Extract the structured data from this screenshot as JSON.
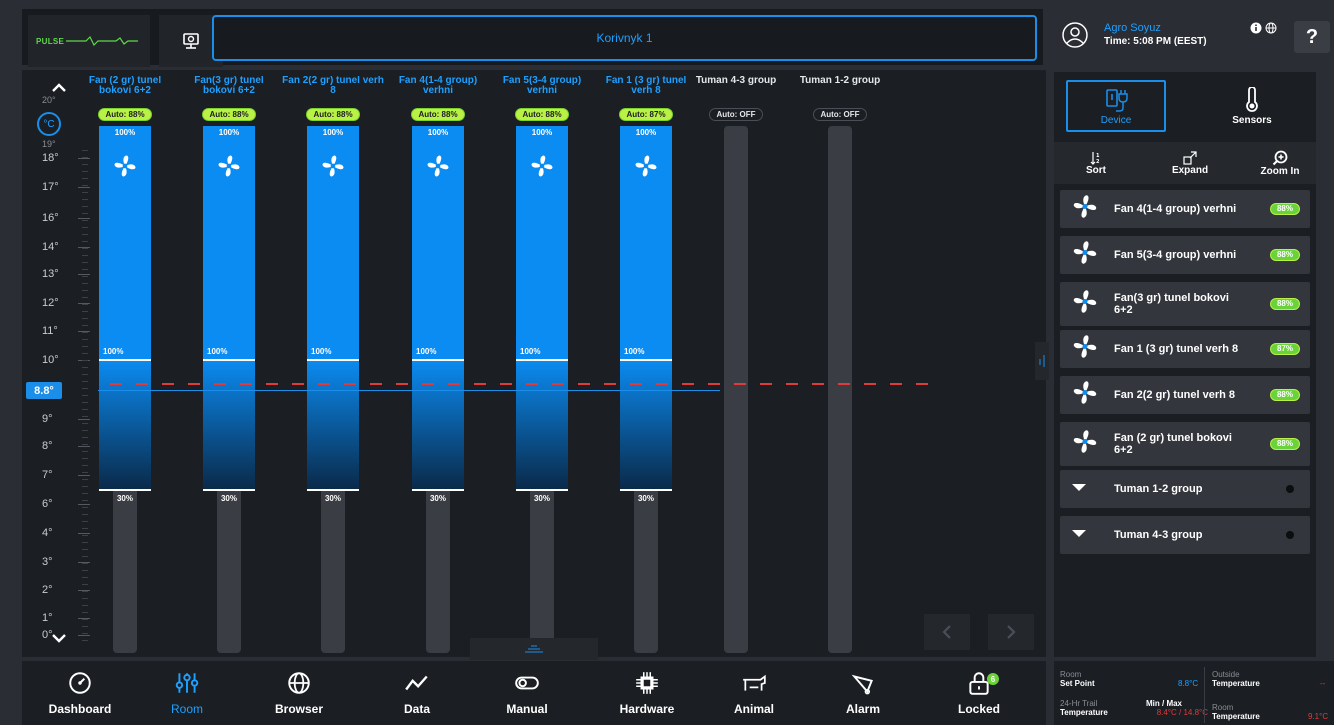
{
  "header": {
    "logo_text": "PULSE",
    "house_title": "Korivnyk 1"
  },
  "user": {
    "name": "Agro Soyuz",
    "time": "Time: 5:08 PM (EEST)",
    "help_label": "?",
    "icons": [
      "info-icon",
      "globe-icon"
    ]
  },
  "scale": {
    "unit": "°C",
    "current_temperature": "8.8°",
    "top_partial_label": "20°",
    "second_partial_label": "19°",
    "ticks": [
      "18°",
      "17°",
      "16°",
      "14°",
      "13°",
      "12°",
      "11°",
      "10°",
      "9°",
      "8°",
      "7°",
      "6°",
      "4°",
      "3°",
      "2°",
      "1°",
      "0°"
    ]
  },
  "columns": [
    {
      "title": "Fan (2 gr) tunel bokovi 6+2",
      "mode": "Auto: 88%",
      "active": true,
      "top_pct": "100%",
      "mid_pct": "100%",
      "min_pct": "30%",
      "icon": "fan-icon"
    },
    {
      "title": "Fan(3 gr) tunel bokovi 6+2",
      "mode": "Auto: 88%",
      "active": true,
      "top_pct": "100%",
      "mid_pct": "100%",
      "min_pct": "30%",
      "icon": "fan-icon"
    },
    {
      "title": "Fan 2(2 gr) tunel verh 8",
      "mode": "Auto: 88%",
      "active": true,
      "top_pct": "100%",
      "mid_pct": "100%",
      "min_pct": "30%",
      "icon": "fan-icon"
    },
    {
      "title": "Fan 4(1-4 group) verhni",
      "mode": "Auto: 88%",
      "active": true,
      "top_pct": "100%",
      "mid_pct": "100%",
      "min_pct": "30%",
      "icon": "fan-icon"
    },
    {
      "title": "Fan 5(3-4 group) verhni",
      "mode": "Auto: 88%",
      "active": true,
      "top_pct": "100%",
      "mid_pct": "100%",
      "min_pct": "30%",
      "icon": "fan-icon"
    },
    {
      "title": "Fan 1 (3 gr) tunel verh 8",
      "mode": "Auto: 87%",
      "active": true,
      "top_pct": "100%",
      "mid_pct": "100%",
      "min_pct": "30%",
      "icon": "fan-icon"
    },
    {
      "title": "Tuman 4-3 group",
      "mode": "Auto: OFF",
      "active": false
    },
    {
      "title": "Tuman 1-2 group",
      "mode": "Auto: OFF",
      "active": false
    }
  ],
  "right_panel": {
    "tabs": {
      "device": "Device",
      "sensors": "Sensors"
    },
    "tools": {
      "sort": "Sort",
      "expand": "Expand",
      "zoom": "Zoom In"
    },
    "devices": [
      {
        "name": "Fan 4(1-4 group) verhni",
        "badge": "88%",
        "icon": "fan-icon"
      },
      {
        "name": "Fan 5(3-4 group) verhni",
        "badge": "88%",
        "icon": "fan-icon"
      },
      {
        "name": "Fan(3 gr) tunel bokovi 6+2",
        "badge": "88%",
        "icon": "fan-icon"
      },
      {
        "name": "Fan 1 (3 gr) tunel verh 8",
        "badge": "87%",
        "icon": "fan-icon"
      },
      {
        "name": "Fan 2(2 gr) tunel verh 8",
        "badge": "88%",
        "icon": "fan-icon"
      },
      {
        "name": "Fan (2 gr) tunel bokovi 6+2",
        "badge": "88%",
        "icon": "fan-icon"
      },
      {
        "name": "Tuman 1-2 group",
        "badge": "",
        "icon": "mist-icon"
      },
      {
        "name": "Tuman 4-3 group",
        "badge": "",
        "icon": "mist-icon"
      }
    ]
  },
  "bottom_nav": [
    {
      "label": "Dashboard",
      "icon": "dashboard-icon",
      "active": false
    },
    {
      "label": "Room",
      "icon": "room-sliders-icon",
      "active": true
    },
    {
      "label": "Browser",
      "icon": "globe-icon",
      "active": false
    },
    {
      "label": "Data",
      "icon": "chart-line-icon",
      "active": false
    },
    {
      "label": "Manual",
      "icon": "toggle-icon",
      "active": false
    },
    {
      "label": "Hardware",
      "icon": "chip-icon",
      "active": false
    },
    {
      "label": "Animal",
      "icon": "cow-icon",
      "active": false
    },
    {
      "label": "Alarm",
      "icon": "alarm-bell-icon",
      "active": false
    },
    {
      "label": "Locked",
      "icon": "lock-icon",
      "active": false,
      "badge": "6"
    }
  ],
  "bottom_info": {
    "room_label": "Room",
    "set_point_label": "Set Point",
    "set_point_value": "8.8°C",
    "trail_label": "24-Hr Trail",
    "trail_sub": "Temperature",
    "minmax_label": "Min / Max",
    "minmax_value": "8.4°C / 14.8°C",
    "outside_label": "Outside",
    "outside_sub": "Temperature",
    "outside_value": "--",
    "room2_label": "Room",
    "room2_sub": "Temperature",
    "room2_value": "9.1°C"
  },
  "colors": {
    "accent": "#1a8ee8",
    "active_chip": "#b9f244",
    "setpoint_line": "#e03b3b",
    "panel_bg": "#1b1e23"
  }
}
